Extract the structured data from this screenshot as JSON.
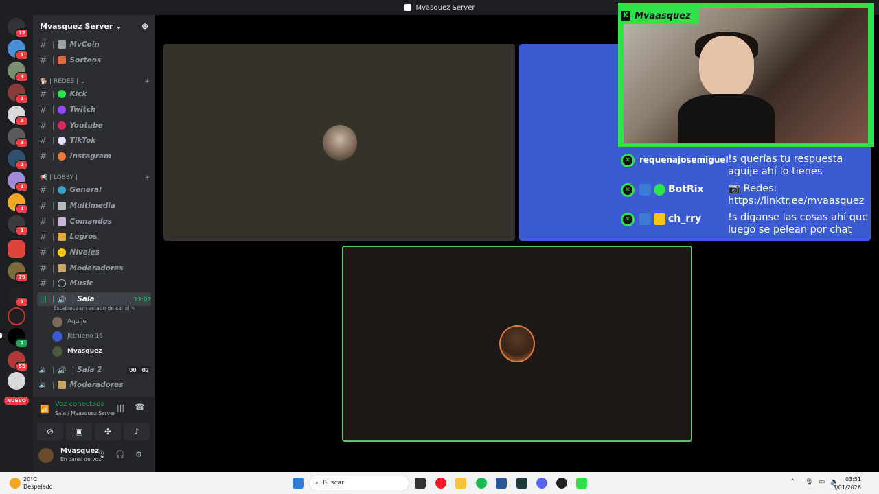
{
  "window": {
    "title": "Mvasquez Server"
  },
  "servers": {
    "badges": [
      "12",
      "1",
      "3",
      "1",
      "3",
      "3",
      "2",
      "1",
      "1",
      "1",
      "1",
      "79",
      "1",
      "55",
      "1"
    ],
    "nuevo": "NUEVO"
  },
  "server": {
    "name": "Mvasquez Server"
  },
  "channels_top": [
    {
      "label": "MvCoin"
    },
    {
      "label": "Sorteos"
    }
  ],
  "categories": {
    "redes": "REDES",
    "lobby": "LOBBY"
  },
  "channels_redes": [
    {
      "label": "Kick"
    },
    {
      "label": "Twitch"
    },
    {
      "label": "Youtube"
    },
    {
      "label": "TikTok"
    },
    {
      "label": "Instagram"
    }
  ],
  "channels_lobby": [
    {
      "label": "General"
    },
    {
      "label": "Multimedia"
    },
    {
      "label": "Comandos"
    },
    {
      "label": "Logros"
    },
    {
      "label": "Niveles"
    },
    {
      "label": "Moderadores"
    },
    {
      "label": "Music"
    }
  ],
  "voice": {
    "sala": {
      "label": "Sala",
      "time": "13:02",
      "status_hint": "Establece un estado de canal"
    },
    "members": [
      "Aquije",
      "Jktrueno 16",
      "Mvasquez"
    ],
    "sala2": {
      "label": "Sala 2",
      "count_a": "00",
      "count_b": "02"
    },
    "moderadores": {
      "label": "Moderadores"
    }
  },
  "voice_panel": {
    "status": "Voz conectada",
    "channel": "Sala / Mvasquez Server"
  },
  "user_panel": {
    "name": "Mvasquez",
    "status": "En canal de voz"
  },
  "overlay": {
    "brand": "Mvaasquez",
    "chat": [
      {
        "user": "requenajosemiguel",
        "message": "!s querías tu respuesta aguije ahí lo tienes"
      },
      {
        "user": "BotRix",
        "message": "📷 Redes: https://linktr.ee/mvaasquez"
      },
      {
        "user": "ch_rry",
        "message": "!s díganse las cosas ahí que luego se pelean por chat"
      }
    ]
  },
  "taskbar": {
    "temp": "20°C",
    "weather": "Despejado",
    "search_placeholder": "Buscar",
    "time": "03:51",
    "date": "3/01/2026"
  },
  "colors": {
    "accent_green": "#2de34a",
    "voice_green": "#23a55a",
    "tile_blue": "#3a5bd1",
    "badge_red": "#f23f43"
  }
}
